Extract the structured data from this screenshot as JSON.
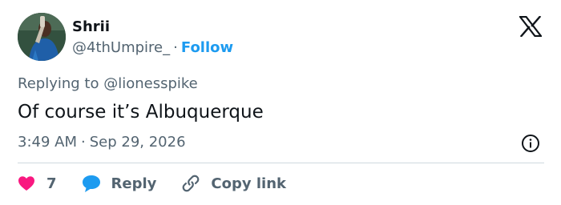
{
  "author": {
    "name": "Shrii",
    "handle": "@4thUmpire_",
    "separator": "·",
    "follow_label": "Follow"
  },
  "reply_context": "Replying to @lionesspike",
  "tweet": {
    "text": "Of course it’s Albuquerque",
    "time": "3:49 AM",
    "separator": "·",
    "date": "Sep 29, 2026"
  },
  "actions": {
    "like_count": "7",
    "reply_label": "Reply",
    "copy_link_label": "Copy link"
  },
  "icons": {
    "brand": "x-logo-icon",
    "info": "info-icon",
    "like": "heart-icon",
    "reply": "speech-bubble-icon",
    "copy": "link-icon"
  },
  "colors": {
    "follow": "#1d9bf0",
    "heart": "#f91880",
    "reply_bubble": "#1d9bf0",
    "secondary_text": "#536471",
    "divider": "#cfd9de"
  }
}
